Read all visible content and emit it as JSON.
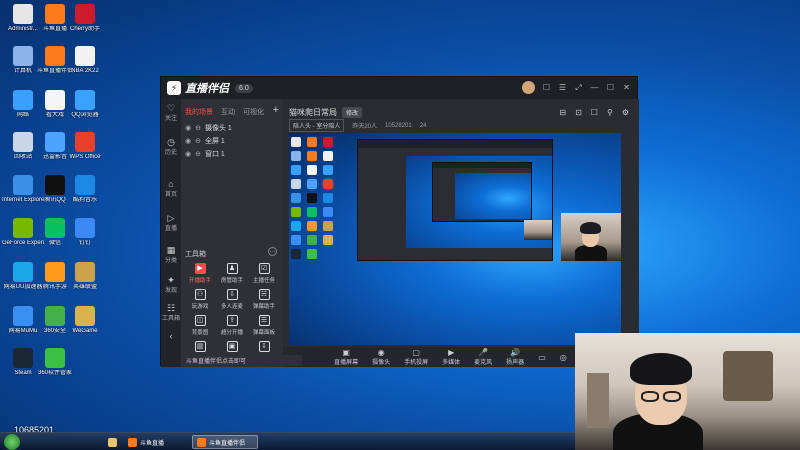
{
  "desktop": {
    "icons": [
      {
        "label": "Administr...",
        "color": "#e6e6e6"
      },
      {
        "label": "斗鱼直播",
        "color": "#ff7a1a"
      },
      {
        "label": "Cherry助手",
        "color": "#cc1b2b"
      },
      {
        "label": "计算机",
        "color": "#8ab4e8"
      },
      {
        "label": "斗鱼直播伴侣",
        "color": "#ff7a1a"
      },
      {
        "label": "NBA 2K22",
        "color": "#f2f2f2"
      },
      {
        "label": "网络",
        "color": "#3aa0ff"
      },
      {
        "label": "看大戏",
        "color": "#f5f5f5"
      },
      {
        "label": "QQ浏览器",
        "color": "#39a1ff"
      },
      {
        "label": "回收站",
        "color": "#c9d6e8"
      },
      {
        "label": "迅雷影音",
        "color": "#4da3ff"
      },
      {
        "label": "WPS Office",
        "color": "#e8402b"
      },
      {
        "label": "Internet Explorer",
        "color": "#3b8fe8"
      },
      {
        "label": "腾讯QQ",
        "color": "#111111"
      },
      {
        "label": "酷狗音乐",
        "color": "#1e88e5"
      },
      {
        "label": "GeForce Experience",
        "color": "#76b900"
      },
      {
        "label": "微信",
        "color": "#07c160"
      },
      {
        "label": "钉钉",
        "color": "#3d8af7"
      },
      {
        "label": "网易UU加速器",
        "color": "#1ba6e8"
      },
      {
        "label": "腾讯手游",
        "color": "#ff9a1a"
      },
      {
        "label": "英雄联盟",
        "color": "#c9a24a"
      },
      {
        "label": "网易MuMu",
        "color": "#3a8ff0"
      },
      {
        "label": "360安全",
        "color": "#43b04a"
      },
      {
        "label": "WeGame",
        "color": "#d8b24a"
      },
      {
        "label": "Steam",
        "color": "#1b2838"
      },
      {
        "label": "360软件管家",
        "color": "#3bbf45"
      }
    ],
    "room_id": "10685201"
  },
  "window": {
    "title": "直播伴侣",
    "version": "6.0",
    "controls": [
      "☐",
      "☰",
      "⤢",
      "—",
      "☐",
      "✕"
    ],
    "rail": [
      {
        "icon": "♡",
        "label": "关注"
      },
      {
        "icon": "◷",
        "label": "历史"
      },
      {
        "icon": "⌂",
        "label": "首页"
      },
      {
        "icon": "▷",
        "label": "直播"
      },
      {
        "icon": "▦",
        "label": "分类"
      },
      {
        "icon": "✦",
        "label": "发现"
      },
      {
        "icon": "☷",
        "label": "工具箱"
      },
      {
        "icon": "‹",
        "label": ""
      }
    ],
    "sources": {
      "tabs": [
        "我的场景",
        "互动",
        "可视化"
      ],
      "items": [
        "摄像头 1",
        "全屏 1",
        "窗口 1"
      ],
      "tools_header": "工具箱",
      "tools": [
        {
          "label": "开播助手",
          "icon": "▶",
          "highlight": true
        },
        {
          "label": "房管助手",
          "icon": "♟",
          "highlight": false
        },
        {
          "label": "主播任务",
          "icon": "☑",
          "highlight": false
        },
        {
          "label": "玩游戏",
          "icon": "⚇",
          "highlight": false
        },
        {
          "label": "多人连麦",
          "icon": "⇩",
          "highlight": false
        },
        {
          "label": "弹幕助手",
          "icon": "☵",
          "highlight": false
        },
        {
          "label": "背景图",
          "icon": "◫",
          "highlight": false
        },
        {
          "label": "超分开播",
          "icon": "⇪",
          "highlight": false
        },
        {
          "label": "弹幕面板",
          "icon": "☰",
          "highlight": false
        },
        {
          "label": "",
          "icon": "▥",
          "highlight": false
        },
        {
          "label": "",
          "icon": "▣",
          "highlight": false
        },
        {
          "label": "",
          "icon": "⇩",
          "highlight": false
        }
      ],
      "hint": "斗鱼直播伴侣点击即可"
    },
    "preview": {
      "room_title": "猫咪爬日常局",
      "edit_chip": "修改",
      "category": "陪人头 - 室分陪人",
      "viewers": "昨天20人",
      "room_id": "10528201",
      "fans": "24",
      "toolbar_icons": [
        "⊟",
        "⊡",
        "☐",
        "⚲",
        "⚙"
      ],
      "bottom": [
        {
          "icon": "▣",
          "label": "直播屏幕"
        },
        {
          "icon": "◉",
          "label": "摄像头"
        },
        {
          "icon": "▢",
          "label": "手机投屏"
        },
        {
          "icon": "▶",
          "label": "多媒体"
        },
        {
          "icon": "🎤",
          "label": "麦克风"
        },
        {
          "icon": "🔊",
          "label": "扬声器"
        },
        {
          "icon": "▭",
          "label": ""
        },
        {
          "icon": "◎",
          "label": ""
        },
        {
          "icon": "⚙",
          "label": ""
        }
      ]
    }
  },
  "taskbar": {
    "items": [
      {
        "label": "",
        "active": false
      },
      {
        "label": "斗鱼直播",
        "active": false
      },
      {
        "label": "斗鱼直播伴侣",
        "active": true
      }
    ]
  },
  "colors": {
    "accent": "#ff4b4b",
    "window_bg": "#2b2d33",
    "desktop": "#0e6fd6"
  }
}
